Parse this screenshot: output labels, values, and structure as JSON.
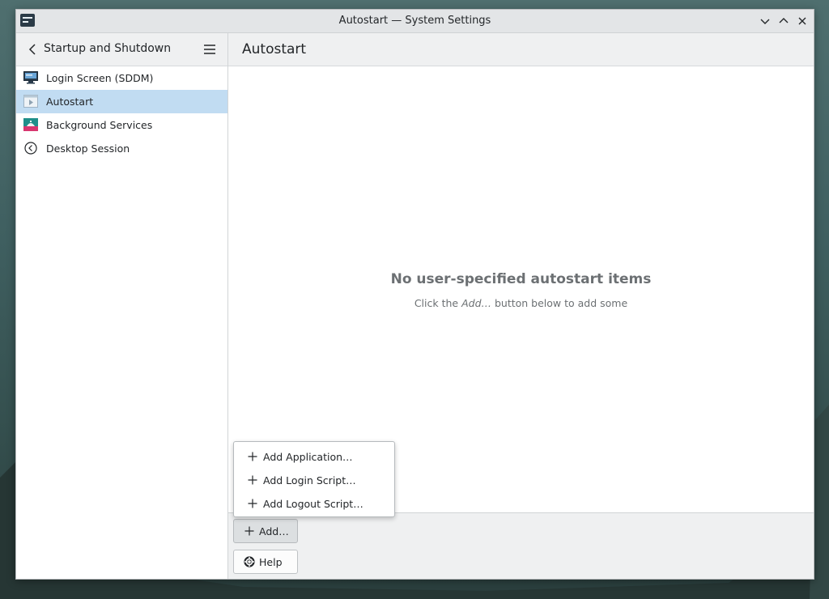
{
  "window": {
    "title": "Autostart — System Settings"
  },
  "sidebar": {
    "header_title": "Startup and Shutdown",
    "items": [
      {
        "label": "Login Screen (SDDM)",
        "icon": "monitor-icon",
        "active": false
      },
      {
        "label": "Autostart",
        "icon": "autostart-icon",
        "active": true
      },
      {
        "label": "Background Services",
        "icon": "services-icon",
        "active": false
      },
      {
        "label": "Desktop Session",
        "icon": "session-icon",
        "active": false
      }
    ]
  },
  "main": {
    "page_title": "Autostart",
    "empty_title": "No user-specified autostart items",
    "empty_hint_before": "Click the ",
    "empty_hint_em": "Add…",
    "empty_hint_after": " button below to add some"
  },
  "menu": {
    "items": [
      {
        "label": "Add Application…"
      },
      {
        "label": "Add Login Script…"
      },
      {
        "label": "Add Logout Script…"
      }
    ]
  },
  "footer": {
    "add_label": "Add…",
    "help_label": "Help"
  },
  "colors": {
    "selection": "#c1dcf2",
    "text": "#232629",
    "muted_text": "#6c7073"
  }
}
